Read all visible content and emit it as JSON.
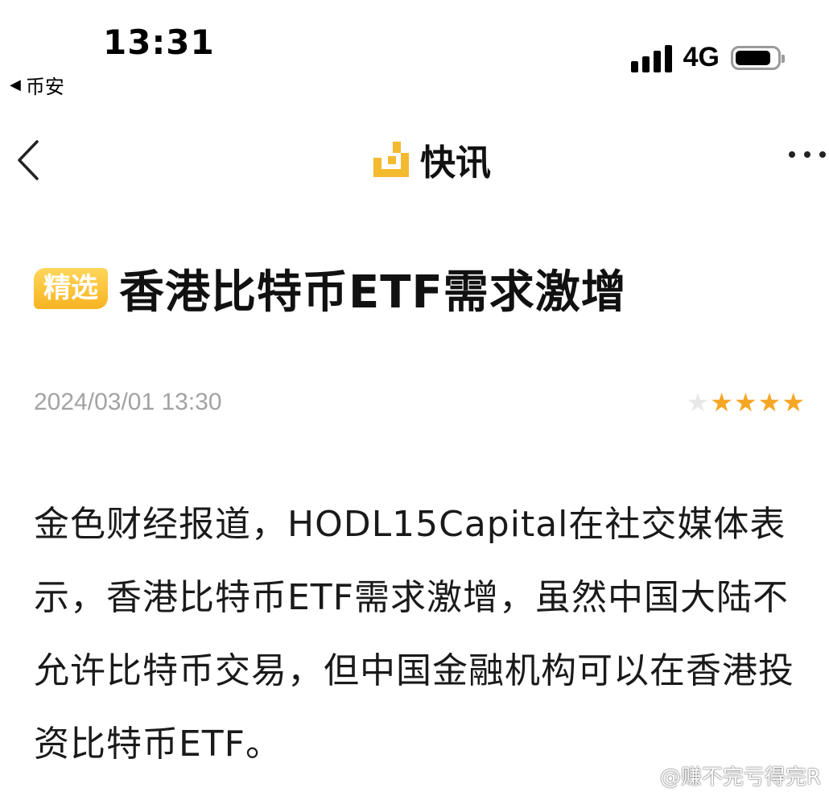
{
  "status_bar": {
    "time": "13:31",
    "back_app_label": "币安",
    "network": "4G",
    "battery_level": 0.85
  },
  "nav": {
    "title": "快讯",
    "logo_color": "#F3BA2F"
  },
  "article": {
    "badge": "精选",
    "title": "香港比特币ETF需求激增",
    "timestamp": "2024/03/01 13:30",
    "rating": {
      "filled": 4,
      "total": 5
    },
    "body": "金色财经报道，HODL15Capital在社交媒体表示，香港比特币ETF需求激增，虽然中国大陆不允许比特币交易，但中国金融机构可以在香港投资比特币ETF。"
  },
  "watermark": {
    "text": "@赚不完亏得完R"
  },
  "colors": {
    "accent": "#F3BA2F",
    "star_on": "#F5A623",
    "star_off": "#E8E8E8",
    "timestamp": "#A3A3A3"
  }
}
